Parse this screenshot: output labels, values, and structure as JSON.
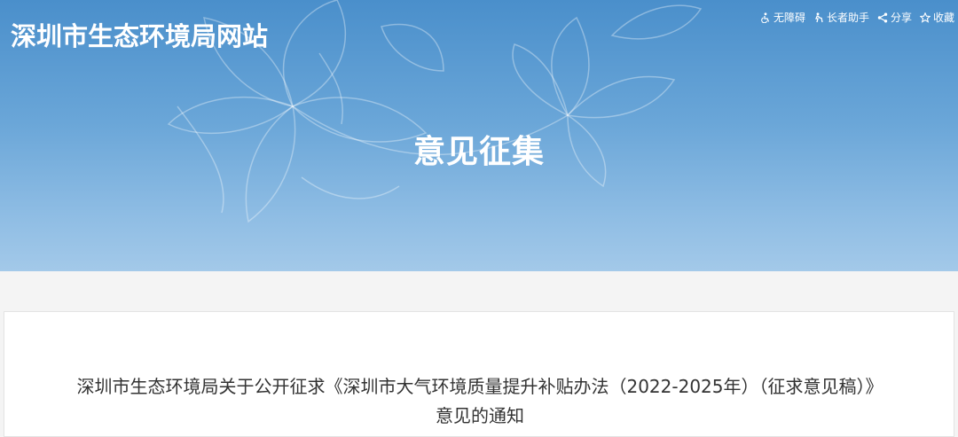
{
  "site": {
    "title": "深圳市生态环境局网站"
  },
  "toolbar": {
    "items": [
      {
        "label": "无障碍",
        "icon": "accessibility-icon"
      },
      {
        "label": "长者助手",
        "icon": "elder-assist-icon"
      },
      {
        "label": "分享",
        "icon": "share-icon"
      },
      {
        "label": "收藏",
        "icon": "star-icon"
      }
    ]
  },
  "banner": {
    "heading": "意见征集"
  },
  "article": {
    "title": "深圳市生态环境局关于公开征求《深圳市大气环境质量提升补贴办法（2022-2025年）（征求意见稿）》意见的通知"
  },
  "colors": {
    "banner_top": "#4a8fcb",
    "banner_bottom": "#a3c9e9",
    "page_bg": "#f4f4f4",
    "title_text": "#333333"
  }
}
